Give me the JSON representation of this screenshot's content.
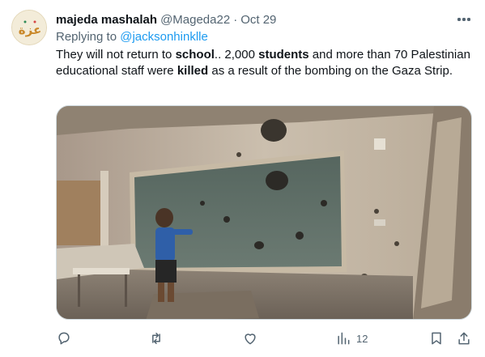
{
  "tweet": {
    "author_name": "majeda mashalah",
    "author_handle": "@Mageda22",
    "separator": "·",
    "date": "Oct 29",
    "replying_prefix": "Replying to",
    "replying_to": "@jacksonhinklle",
    "text_parts": [
      {
        "t": "They will not return to ",
        "b": false
      },
      {
        "t": "school",
        "b": true
      },
      {
        "t": ".. 2,000 ",
        "b": false
      },
      {
        "t": "students",
        "b": true
      },
      {
        "t": " and more than 70 Palestinian educational staff were ",
        "b": false
      },
      {
        "t": "killed",
        "b": true
      },
      {
        "t": " as a result of the bombing on the Gaza Strip.",
        "b": false
      }
    ],
    "avatar_text": "عزة",
    "media_icon": "photo-bombed-classroom",
    "views_count": "12"
  },
  "icons": {
    "more": "more-horizontal-icon",
    "reply": "reply-icon",
    "retweet": "retweet-icon",
    "like": "heart-icon",
    "views": "views-icon",
    "bookmark": "bookmark-icon",
    "share": "share-icon"
  },
  "colors": {
    "text": "#0f1419",
    "secondary": "#536471",
    "link": "#1d9bf0",
    "border": "#cfd9de"
  }
}
